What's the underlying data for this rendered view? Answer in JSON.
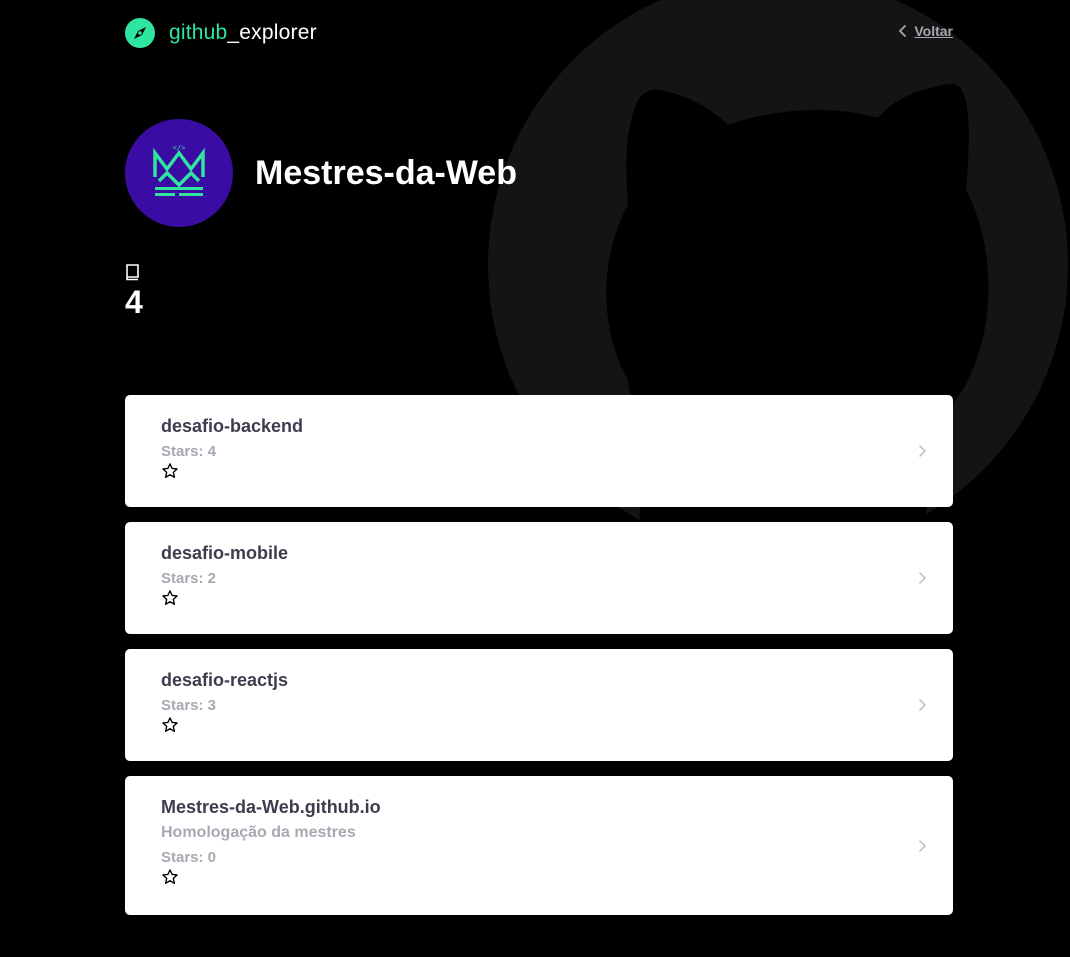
{
  "header": {
    "brand_primary": "github",
    "brand_secondary": "_explorer",
    "brand_icon": "compass-icon",
    "back_label": "Voltar",
    "back_icon": "chevron-left-icon"
  },
  "profile": {
    "name": "Mestres-da-Web",
    "avatar_icon": "crown-logo"
  },
  "stats": {
    "icon": "book-icon",
    "repo_count": "4"
  },
  "colors": {
    "background": "#000000",
    "accent": "#2ee6a0",
    "avatar_bg": "#3a0ca3",
    "card_bg": "#ffffff",
    "repo_title": "#3d3d4d",
    "muted": "#a8a8b3"
  },
  "repos": [
    {
      "name": "desafio-backend",
      "description": "",
      "stars": "Stars: 4"
    },
    {
      "name": "desafio-mobile",
      "description": "",
      "stars": "Stars: 2"
    },
    {
      "name": "desafio-reactjs",
      "description": "",
      "stars": "Stars: 3"
    },
    {
      "name": "Mestres-da-Web.github.io",
      "description": "Homologação da mestres",
      "stars": "Stars: 0"
    }
  ]
}
